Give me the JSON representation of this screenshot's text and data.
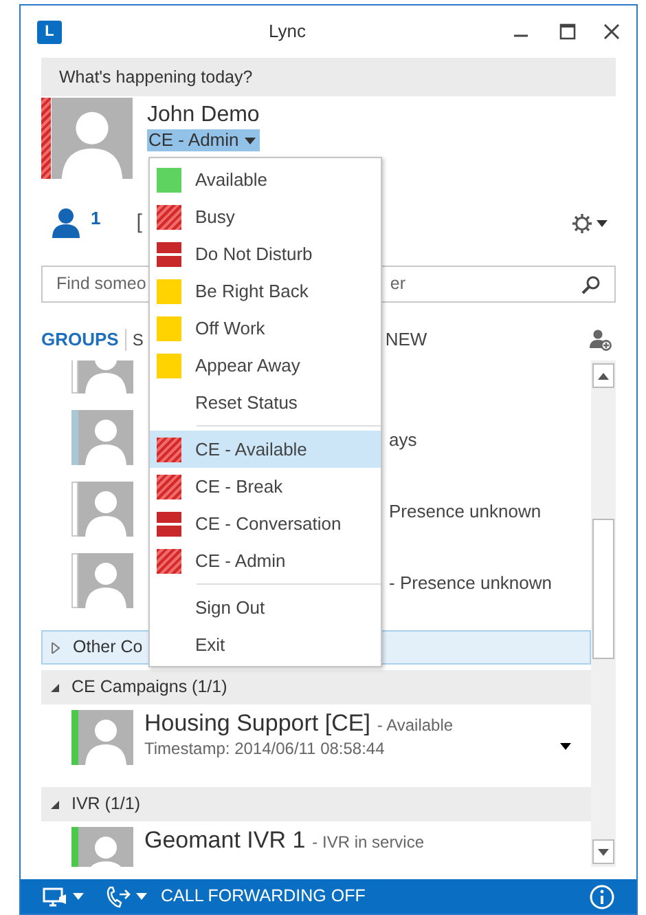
{
  "window": {
    "title": "Lync",
    "logo_letter": "L"
  },
  "note": {
    "placeholder": "What's happening today?"
  },
  "me": {
    "name": "John Demo",
    "swatch": {
      "kind": "busy"
    },
    "status": "CE - Admin",
    "menu_open": true
  },
  "contacts_count": "1",
  "note_fragment": "[",
  "search": {
    "placeholder": "Find someo",
    "tail": "er"
  },
  "tabs": [
    {
      "label": "GROUPS",
      "selected": true
    },
    {
      "label": "S",
      "selected": false
    },
    {
      "label": "NEW",
      "selected": false
    }
  ],
  "list": [
    {
      "kind": "contact",
      "selected": false
    },
    {
      "kind": "contact",
      "selected": true,
      "status": "ays"
    },
    {
      "kind": "contact",
      "selected": false,
      "status": "Presence unknown"
    },
    {
      "kind": "contact",
      "selected": false,
      "status": "- Presence unknown"
    },
    {
      "kind": "group",
      "label": "Other Co",
      "expanded": false,
      "selected": true
    },
    {
      "kind": "group",
      "label": "CE Campaigns (1/1)",
      "expanded": true,
      "selected": false
    },
    {
      "kind": "contact",
      "selected": false,
      "band": {
        "kind": "available"
      },
      "name": "Housing Support [CE]",
      "status": "- Available",
      "note": "Timestamp: 2014/06/11 08:58:44",
      "has_menu": true
    },
    {
      "kind": "group",
      "label": "IVR (1/1)",
      "expanded": true,
      "selected": false
    },
    {
      "kind": "contact",
      "selected": false,
      "band": {
        "kind": "available"
      },
      "name": "Geomant IVR 1",
      "status": "- IVR in service"
    }
  ],
  "status_menu": [
    {
      "kind": "status",
      "swatch": {
        "kind": "available"
      },
      "label": "Available",
      "selected": false
    },
    {
      "kind": "status",
      "swatch": {
        "kind": "busy"
      },
      "label": "Busy",
      "selected": false
    },
    {
      "kind": "status",
      "swatch": {
        "kind": "dnd"
      },
      "label": "Do Not Disturb",
      "selected": false
    },
    {
      "kind": "status",
      "swatch": {
        "kind": "away"
      },
      "label": "Be Right Back",
      "selected": false
    },
    {
      "kind": "status",
      "swatch": {
        "kind": "away"
      },
      "label": "Off Work",
      "selected": false
    },
    {
      "kind": "status",
      "swatch": {
        "kind": "away"
      },
      "label": "Appear Away",
      "selected": false
    },
    {
      "kind": "action",
      "label": "Reset Status",
      "selected": false
    },
    {
      "kind": "divider"
    },
    {
      "kind": "status",
      "swatch": {
        "kind": "busy"
      },
      "label": "CE - Available",
      "selected": true
    },
    {
      "kind": "status",
      "swatch": {
        "kind": "busy"
      },
      "label": "CE - Break",
      "selected": false
    },
    {
      "kind": "status",
      "swatch": {
        "kind": "dnd"
      },
      "label": "CE - Conversation",
      "selected": false
    },
    {
      "kind": "status",
      "swatch": {
        "kind": "busy"
      },
      "label": "CE - Admin",
      "selected": false
    },
    {
      "kind": "divider"
    },
    {
      "kind": "action",
      "label": "Sign Out",
      "selected": false
    },
    {
      "kind": "action",
      "label": "Exit",
      "selected": false
    }
  ],
  "footer": {
    "text": "CALL FORWARDING OFF"
  }
}
